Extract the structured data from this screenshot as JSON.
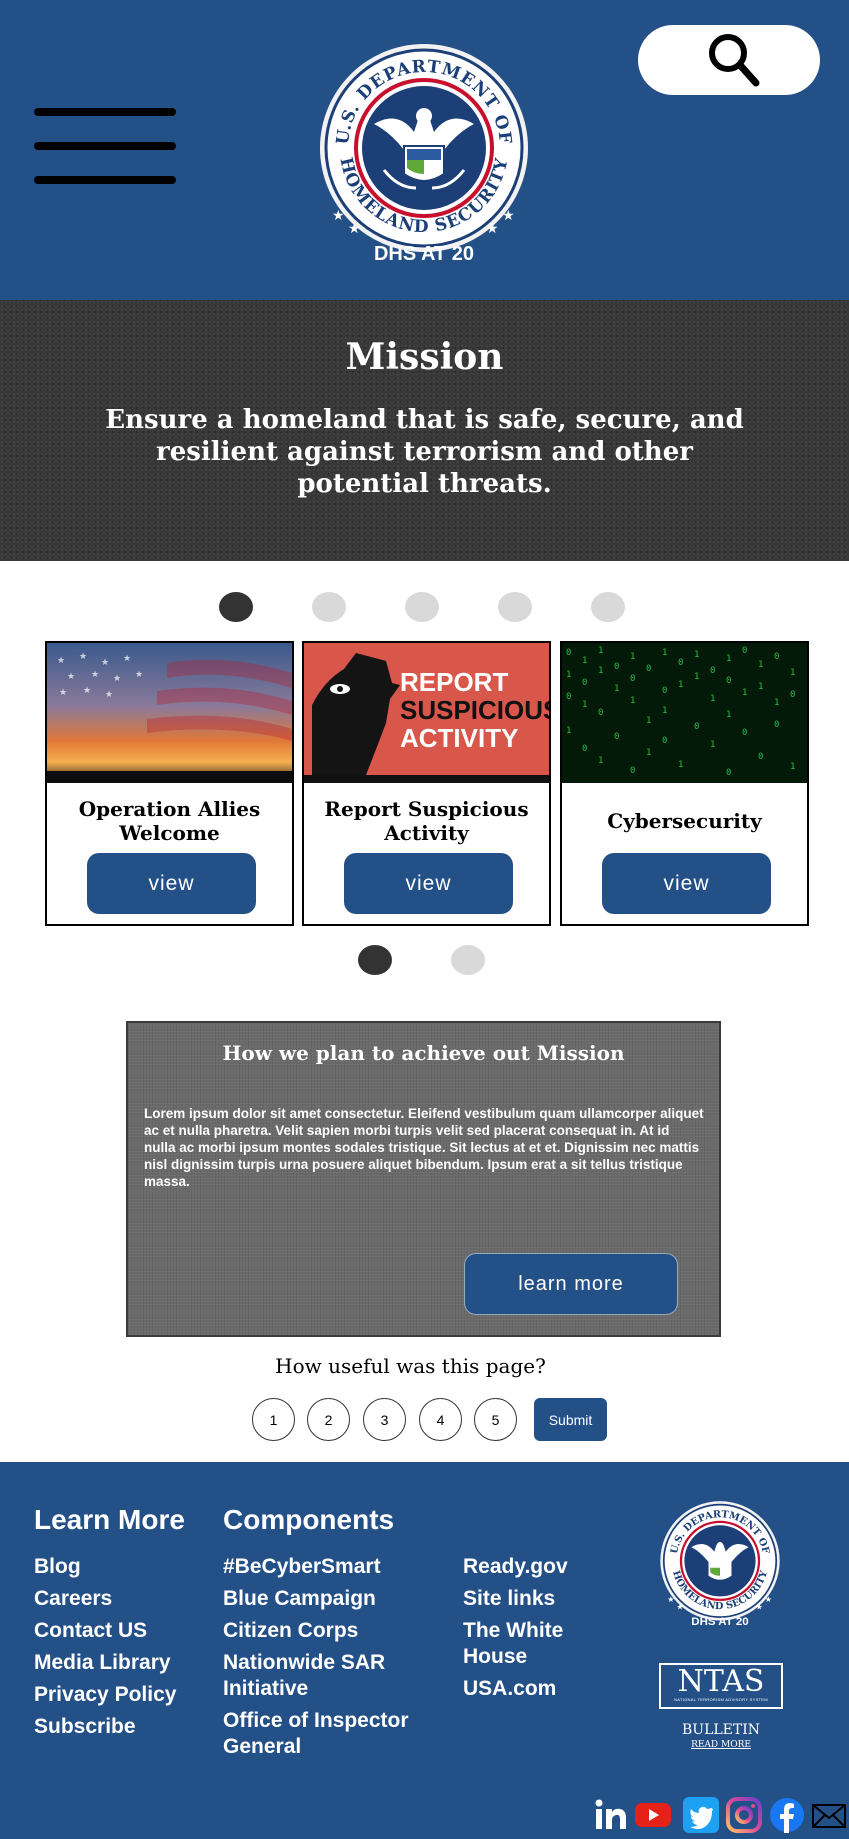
{
  "header": {
    "logo_alt": "U.S. Department of Homeland Security",
    "logo_ring_text": "U.S. DEPARTMENT OF HOMELAND SECURITY",
    "logo_tagline": "DHS AT 20",
    "menu_icon": "hamburger-icon",
    "search_icon": "search-icon"
  },
  "mission": {
    "title": "Mission",
    "statement": "Ensure a homeland that is safe, secure, and resilient against terrorism and other potential threats."
  },
  "carousel": {
    "top_dots": 5,
    "active_top": 0,
    "bottom_dots": 2,
    "active_bottom": 0,
    "cards": [
      {
        "title": "Operation Allies Welcome",
        "button": "view"
      },
      {
        "title": "Report Suspicious Activity",
        "button": "view",
        "image_text": [
          "REPORT",
          "SUSPICIOUS",
          "ACTIVITY"
        ]
      },
      {
        "title": "Cybersecurity",
        "button": "view"
      }
    ]
  },
  "plan": {
    "title": "How we plan to achieve out Mission",
    "body": "Lorem ipsum dolor sit amet consectetur. Eleifend vestibulum quam ullamcorper aliquet ac et nulla pharetra. Velit sapien morbi turpis velit sed placerat consequat in. At id nulla ac morbi ipsum montes sodales tristique. Sit lectus at et et. Dignissim nec mattis nisl dignissim turpis urna posuere aliquet bibendum. Ipsum erat a sit tellus tristique massa.",
    "button": "learn more"
  },
  "feedback": {
    "question": "How useful was this page?",
    "options": [
      "1",
      "2",
      "3",
      "4",
      "5"
    ],
    "submit": "Submit"
  },
  "footer": {
    "learn_more_heading": "Learn More",
    "learn_more": [
      "Blog",
      "Careers",
      "Contact US",
      "Media Library",
      "Privacy Policy",
      "Subscribe"
    ],
    "components_heading": "Components",
    "components": [
      "#BeCyberSmart",
      "Blue Campaign",
      "Citizen Corps",
      "Nationwide SAR Initiative",
      "Office of Inspector General"
    ],
    "more_links": [
      "Ready.gov",
      "Site links",
      "The White House",
      "USA.com"
    ],
    "ntas": {
      "title": "NTAS",
      "subtitle": "NATIONAL TERRORISM ADVISORY SYSTEM",
      "bulletin": "BULLETIN",
      "read_more": "READ MORE"
    },
    "social_icons": [
      "linkedin-icon",
      "youtube-icon",
      "twitter-icon",
      "instagram-icon",
      "facebook-icon",
      "email-icon"
    ],
    "colors": {
      "linkedin": "#0a66c2",
      "youtube": "#e62117",
      "twitter": "#1da1f2",
      "facebook": "#1877f2"
    }
  },
  "colors": {
    "primary": "#245088",
    "mission_bg": "#383838",
    "plan_bg": "#6a6a6a"
  }
}
